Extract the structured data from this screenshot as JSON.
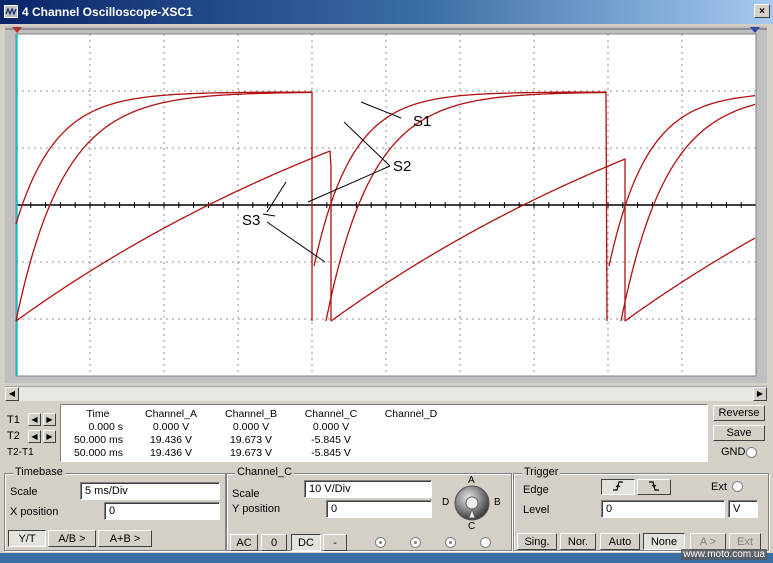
{
  "window": {
    "title": "4 Channel Oscilloscope-XSC1",
    "close_glyph": "×",
    "icon": "oscilloscope-icon"
  },
  "scope": {
    "background": "#ffffff",
    "grid_color": "#909090",
    "trace_color": "#b01010",
    "cursor_color": "#00c8d8",
    "annotations": [
      "S1",
      "S2",
      "S3"
    ]
  },
  "readout": {
    "cursor_rows": [
      "T1",
      "T2",
      "T2-T1"
    ],
    "headers": [
      "Time",
      "Channel_A",
      "Channel_B",
      "Channel_C",
      "Channel_D"
    ],
    "rows": [
      [
        "0.000 s",
        "0.000 V",
        "0.000 V",
        "0.000 V",
        ""
      ],
      [
        "50.000 ms",
        "19.436 V",
        "19.673 V",
        "-5.845 V",
        ""
      ],
      [
        "50.000 ms",
        "19.436 V",
        "19.673 V",
        "-5.845 V",
        ""
      ]
    ]
  },
  "right_buttons": {
    "reverse": "Reverse",
    "save": "Save",
    "gnd": "GND"
  },
  "timebase": {
    "title": "Timebase",
    "scale_label": "Scale",
    "scale_value": "5 ms/Div",
    "xpos_label": "X position",
    "xpos_value": "0",
    "mode_yt": "Y/T",
    "mode_ab": "A/B >",
    "mode_apb": "A+B >"
  },
  "channel": {
    "title": "Channel_C",
    "scale_label": "Scale",
    "scale_value": "10  V/Div",
    "ypos_label": "Y position",
    "ypos_value": "0",
    "ac": "AC",
    "zero": "0",
    "dc": "DC",
    "minus": "-",
    "knob_labels": {
      "a": "A",
      "b": "B",
      "c": "C",
      "d": "D"
    }
  },
  "trigger": {
    "title": "Trigger",
    "edge_label": "Edge",
    "ext_label": "Ext",
    "level_label": "Level",
    "level_value": "0",
    "level_unit": "V",
    "sing": "Sing.",
    "nor": "Nor.",
    "auto": "Auto",
    "none": "None",
    "a_gt": "A >",
    "ext_btn": "Ext"
  },
  "watermark": "www.moto.com.ua"
}
